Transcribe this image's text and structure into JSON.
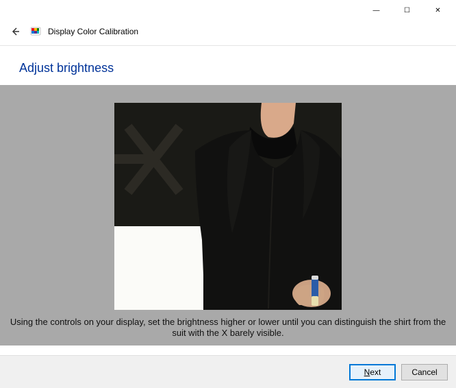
{
  "window": {
    "minimize_glyph": "—",
    "maximize_glyph": "☐",
    "close_glyph": "✕"
  },
  "header": {
    "back_glyph": "←",
    "app_title": "Display Color Calibration"
  },
  "page": {
    "heading": "Adjust brightness",
    "instructions": "Using the controls on your display, set the brightness higher or lower until you can distinguish the shirt from the suit with the X barely visible."
  },
  "buttons": {
    "next_prefix": "N",
    "next_rest": "ext",
    "cancel": "Cancel"
  }
}
